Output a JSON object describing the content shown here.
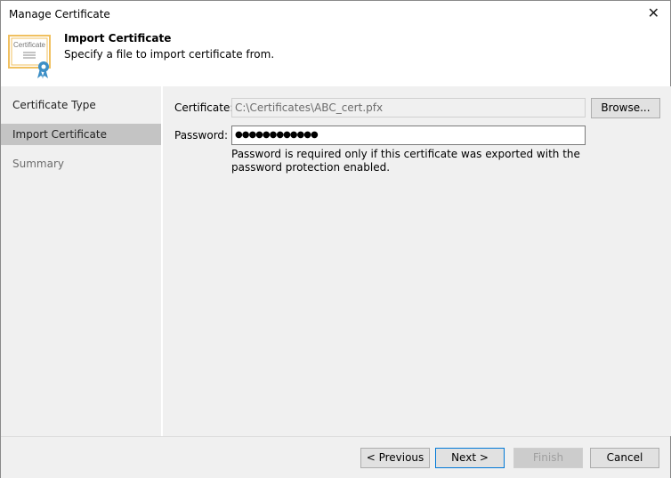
{
  "window": {
    "title": "Manage Certificate",
    "close_icon": "close-icon"
  },
  "header": {
    "title": "Import Certificate",
    "subtitle": "Specify a file to import certificate from.",
    "icon_text": "Certificate"
  },
  "sidebar": {
    "items": [
      {
        "label": "Certificate Type"
      },
      {
        "label": "Import Certificate"
      },
      {
        "label": "Summary"
      }
    ]
  },
  "form": {
    "certificate_label": "Certificate:",
    "certificate_value": "C:\\Certificates\\ABC_cert.pfx",
    "browse_label": "Browse...",
    "password_label": "Password:",
    "password_value": "●●●●●●●●●●●●",
    "hint": "Password is required only if this certificate was exported with the password protection enabled."
  },
  "footer": {
    "previous": "< Previous",
    "next": "Next >",
    "finish": "Finish",
    "cancel": "Cancel"
  }
}
